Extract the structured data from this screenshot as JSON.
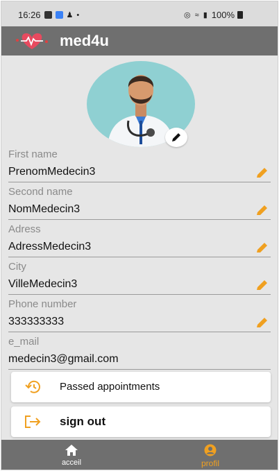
{
  "status_bar": {
    "time": "16:26",
    "battery": "100%"
  },
  "app": {
    "title": "med4u"
  },
  "fields": [
    {
      "label": "First name",
      "value": "PrenomMedecin3",
      "editable": true
    },
    {
      "label": "Second name",
      "value": "NomMedecin3",
      "editable": true
    },
    {
      "label": "Adress",
      "value": "AdressMedecin3",
      "editable": true
    },
    {
      "label": "City",
      "value": "VilleMedecin3",
      "editable": true
    },
    {
      "label": "Phone number",
      "value": "333333333",
      "editable": true
    },
    {
      "label": "e_mail",
      "value": "medecin3@gmail.com",
      "editable": false
    }
  ],
  "actions": {
    "passed_appointments": "Passed appointments",
    "sign_out": "sign out"
  },
  "bottom_nav": {
    "home": "acceil",
    "profile": "profil"
  },
  "colors": {
    "accent": "#f0a020",
    "app_bar": "#6f6f6f",
    "background": "#e6e6e6"
  }
}
